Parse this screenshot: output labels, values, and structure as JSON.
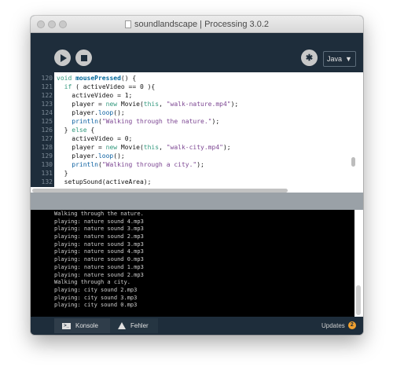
{
  "window": {
    "title": "soundlandscape | Processing 3.0.2"
  },
  "toolbar": {
    "mode_label": "Java",
    "mode_caret": "▼",
    "debug_glyph": "✱"
  },
  "tabs": {
    "active_label": "soundlandscape",
    "menu_caret": "▼"
  },
  "editor": {
    "line_numbers": [
      "120",
      "121",
      "122",
      "123",
      "124",
      "125",
      "126",
      "127",
      "128",
      "129",
      "130",
      "131",
      "132"
    ]
  },
  "console": {
    "lines": [
      "Walking through the nature.",
      "playing: nature sound 4.mp3",
      "playing: nature sound 3.mp3",
      "playing: nature sound 2.mp3",
      "playing: nature sound 3.mp3",
      "playing: nature sound 4.mp3",
      "playing: nature sound 0.mp3",
      "playing: nature sound 1.mp3",
      "playing: nature sound 2.mp3",
      "Walking through a city.",
      "playing: city sound 2.mp3",
      "playing: city sound 3.mp3",
      "playing: city sound 0.mp3"
    ]
  },
  "statusbar": {
    "konsole_label": "Konsole",
    "fehler_label": "Fehler",
    "updates_label": "Updates",
    "updates_count": "2"
  }
}
